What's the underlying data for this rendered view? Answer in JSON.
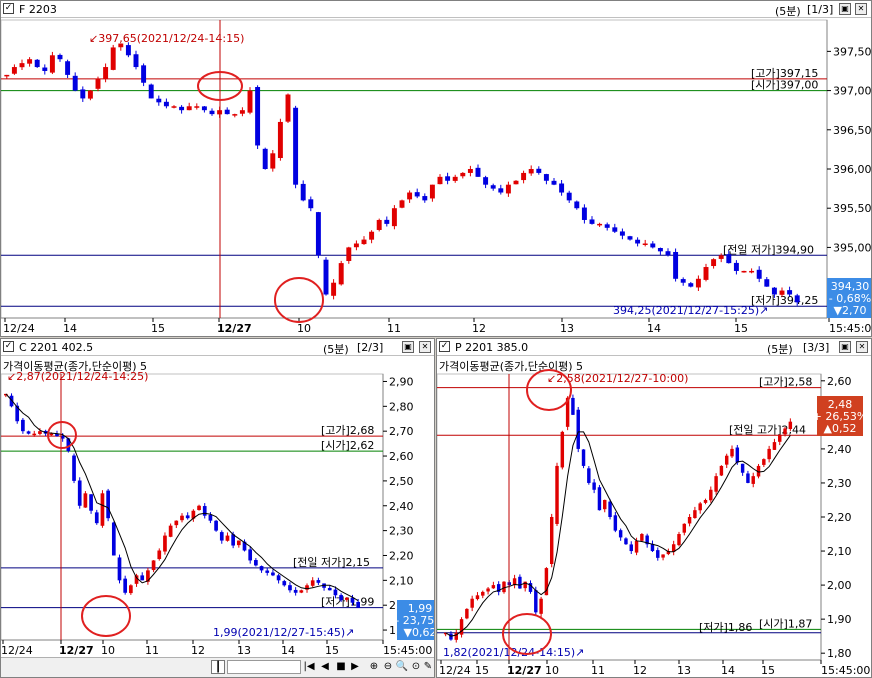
{
  "top": {
    "symbol": "F 2203",
    "period": "(5분)",
    "page": "[1/3]",
    "y_ticks": [
      "397,50",
      "397,00",
      "396,50",
      "396,00",
      "395,50",
      "395,00"
    ],
    "x_ticks": [
      "12/24",
      "14",
      "15",
      "12/27",
      "10",
      "11",
      "12",
      "13",
      "14",
      "15",
      "15:45:00"
    ],
    "high_annot": "397,65(2021/12/24-14:15)",
    "low_annot": "394,25(2021/12/27-15:25)",
    "lines": {
      "high": "[고가]397,15",
      "open": "[시가]397,00",
      "prev_low": "[전일 저가]394,90",
      "low": "[저가]394,25"
    },
    "price_box": {
      "price": "394,30",
      "pct": "- 0,68%",
      "chg": "▼2,70",
      "color": "#3c8ce6"
    },
    "chart_data": {
      "type": "candlestick",
      "ylim": [
        394.1,
        397.9
      ],
      "close_series": [
        397.2,
        397.3,
        397.35,
        397.4,
        397.3,
        397.25,
        397.45,
        397.4,
        397.2,
        397.0,
        396.9,
        397.0,
        397.15,
        397.3,
        397.55,
        397.6,
        397.45,
        397.3,
        397.1,
        396.9,
        396.85,
        396.8,
        396.8,
        396.75,
        396.8,
        396.8,
        396.75,
        396.7,
        396.75,
        396.7,
        396.7,
        396.75,
        397.0,
        396.3,
        396.0,
        396.2,
        396.6,
        396.95,
        395.8,
        395.6,
        395.5,
        394.9,
        394.4,
        394.55,
        394.8,
        395.0,
        395.05,
        395.1,
        395.2,
        395.35,
        395.3,
        395.5,
        395.6,
        395.7,
        395.65,
        395.6,
        395.8,
        395.9,
        395.85,
        395.9,
        395.95,
        396.0,
        395.9,
        395.8,
        395.75,
        395.7,
        395.8,
        395.85,
        395.95,
        396.0,
        395.95,
        395.85,
        395.8,
        395.7,
        395.6,
        395.5,
        395.35,
        395.3,
        395.3,
        395.25,
        395.2,
        395.15,
        395.1,
        395.05,
        395.05,
        395.0,
        394.95,
        394.9,
        394.6,
        394.55,
        394.5,
        394.6,
        394.75,
        394.85,
        394.9,
        394.8,
        394.7,
        394.7,
        394.7,
        394.6,
        394.5,
        394.4,
        394.45,
        394.4,
        394.3
      ]
    }
  },
  "left": {
    "symbol": "C 2201  402.5",
    "period": "(5분)",
    "page": "[2/3]",
    "indicator": "가격이동평균(종가,단순이평) 5",
    "y_ticks": [
      "2,90",
      "2,80",
      "2,70",
      "2,60",
      "2,50",
      "2,40",
      "2,30",
      "2,20",
      "2,10",
      "2,00",
      "1,90"
    ],
    "x_ticks": [
      "12/24",
      "12/27",
      "10",
      "11",
      "12",
      "13",
      "14",
      "15",
      "15:45:00"
    ],
    "high_annot": "2,87(2021/12/24-14:25)",
    "low_annot": "1,99(2021/12/27-15:45)",
    "lines": {
      "high": "[고가]2,68",
      "open": "[시가]2,62",
      "prev_low": "[전일 저가]2,15",
      "low": "[저가]1,99"
    },
    "price_box": {
      "price": "1,99",
      "pct": "- 23,75%",
      "chg": "▼0,62",
      "color": "#3c8ce6"
    },
    "chart_data": {
      "type": "candlestick",
      "ylim": [
        1.86,
        2.93
      ],
      "close_series": [
        2.85,
        2.8,
        2.74,
        2.7,
        2.69,
        2.69,
        2.7,
        2.69,
        2.69,
        2.68,
        2.67,
        2.62,
        2.5,
        2.4,
        2.45,
        2.38,
        2.33,
        2.45,
        2.35,
        2.2,
        2.1,
        2.05,
        2.08,
        2.12,
        2.1,
        2.14,
        2.18,
        2.22,
        2.28,
        2.32,
        2.34,
        2.36,
        2.35,
        2.38,
        2.4,
        2.36,
        2.34,
        2.3,
        2.26,
        2.28,
        2.24,
        2.26,
        2.22,
        2.18,
        2.16,
        2.14,
        2.13,
        2.12,
        2.1,
        2.08,
        2.06,
        2.05,
        2.06,
        2.08,
        2.1,
        2.09,
        2.07,
        2.06,
        2.04,
        2.02,
        2.03,
        2.01,
        1.99
      ]
    }
  },
  "right": {
    "symbol": "P 2201  385.0",
    "period": "(5분)",
    "page": "[3/3]",
    "indicator": "가격이동평균(종가,단순이평) 5",
    "y_ticks": [
      "2,60",
      "2,50",
      "2,40",
      "2,30",
      "2,20",
      "2,10",
      "2,00",
      "1,90",
      "1,80"
    ],
    "x_ticks": [
      "12/24",
      "15",
      "12/27",
      "10",
      "11",
      "12",
      "13",
      "14",
      "15",
      "15:45:00"
    ],
    "high_annot": "2,58(2021/12/27-10:00)",
    "low_annot": "1,82(2021/12/24-14:15)",
    "lines": {
      "high": "[고가]2,58",
      "prev_high": "[전일 고가]2,44",
      "low": "[저가]1,86",
      "open": "[시가]1,87"
    },
    "price_box": {
      "price": "2,48",
      "pct": "+ 26,53%",
      "chg": "▲0,52",
      "color": "#d04020"
    },
    "chart_data": {
      "type": "candlestick",
      "ylim": [
        1.78,
        2.62
      ],
      "close_series": [
        1.86,
        1.84,
        1.86,
        1.9,
        1.93,
        1.96,
        1.97,
        1.98,
        1.99,
        2.0,
        1.98,
        2.01,
        2.0,
        2.02,
        1.99,
        2.01,
        1.98,
        1.92,
        1.96,
        2.05,
        2.2,
        2.35,
        2.45,
        2.55,
        2.5,
        2.4,
        2.35,
        2.3,
        2.28,
        2.22,
        2.25,
        2.2,
        2.16,
        2.14,
        2.12,
        2.1,
        2.13,
        2.15,
        2.12,
        2.1,
        2.08,
        2.09,
        2.1,
        2.12,
        2.15,
        2.18,
        2.2,
        2.22,
        2.24,
        2.25,
        2.28,
        2.32,
        2.35,
        2.38,
        2.4,
        2.36,
        2.33,
        2.3,
        2.32,
        2.35,
        2.37,
        2.4,
        2.42,
        2.44,
        2.46,
        2.48
      ]
    }
  },
  "toolbar": {
    "icons": [
      "zoom-in-icon",
      "zoom-out-icon",
      "search-zoom-icon",
      "zoom-reset-icon",
      "wrench-icon"
    ]
  }
}
